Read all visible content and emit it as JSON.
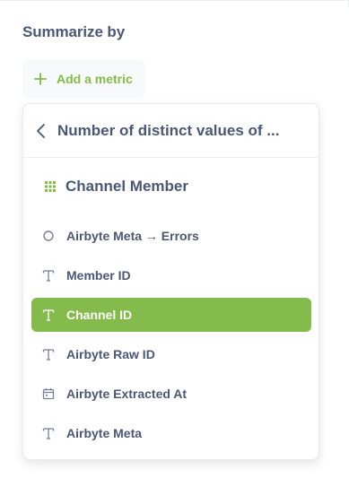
{
  "summarize": {
    "label": "Summarize by",
    "add_metric_label": "Add a metric"
  },
  "popover": {
    "back_title": "Number of distinct values of ...",
    "table_name": "Channel Member",
    "fields": [
      {
        "label": "Airbyte Meta → Errors",
        "icon": "circle-icon",
        "selected": false
      },
      {
        "label": "Member ID",
        "icon": "text-type-icon",
        "selected": false
      },
      {
        "label": "Channel ID",
        "icon": "text-type-icon",
        "selected": true
      },
      {
        "label": "Airbyte Raw ID",
        "icon": "text-type-icon",
        "selected": false
      },
      {
        "label": "Airbyte Extracted At",
        "icon": "calendar-icon",
        "selected": false
      },
      {
        "label": "Airbyte Meta",
        "icon": "text-type-icon",
        "selected": false
      }
    ]
  },
  "colors": {
    "accent": "#84bb4c",
    "text": "#4c5773",
    "icon_muted": "#949aab"
  }
}
